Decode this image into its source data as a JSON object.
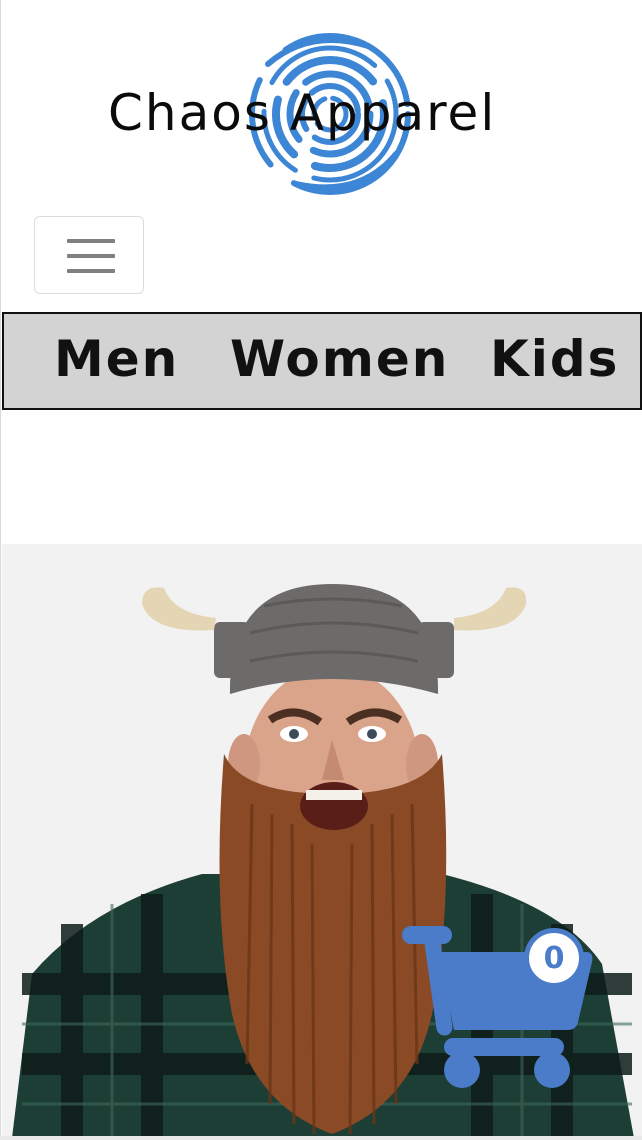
{
  "header": {
    "logo_text": "Chaos Apparel",
    "logo_icon": "swirl-icon",
    "menu_toggle_icon": "hamburger-icon"
  },
  "nav": {
    "items": [
      {
        "label": "Men"
      },
      {
        "label": "Women"
      },
      {
        "label": "Kids"
      }
    ]
  },
  "hero": {
    "image_icon": "viking-beard-hat-photo"
  },
  "cart": {
    "icon": "shopping-cart-icon",
    "count": "0"
  },
  "colors": {
    "brand_blue": "#4a7cc9",
    "logo_blue": "#3d86d6",
    "nav_background": "#d3d3d3",
    "nav_border": "#111111",
    "beard": "#8a4a26",
    "hat": "#6d6a6a",
    "horn": "#e4d6b4",
    "shirt": "#1d3e34"
  }
}
